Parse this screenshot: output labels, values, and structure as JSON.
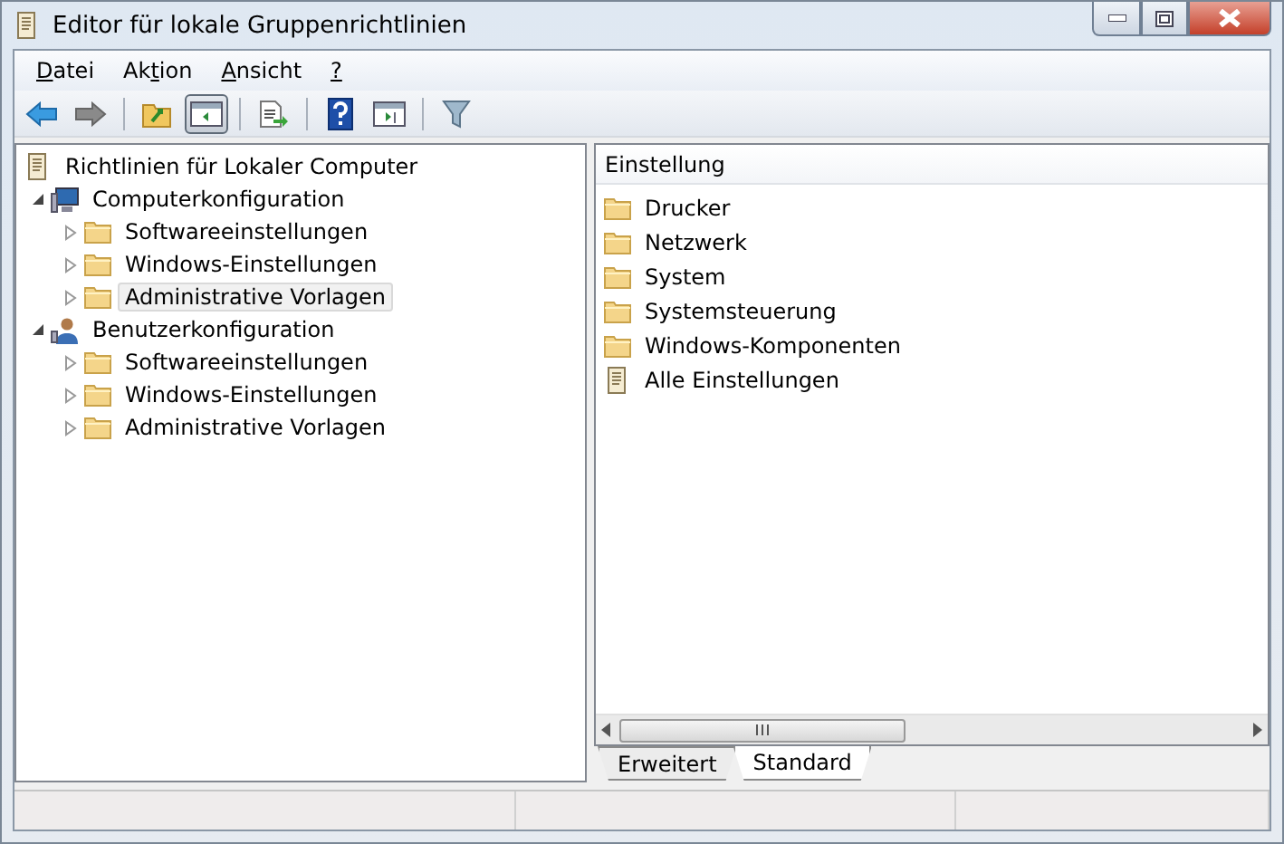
{
  "window": {
    "title": "Editor für lokale Gruppenrichtlinien"
  },
  "menu": [
    {
      "key": "D",
      "after": "atei"
    },
    {
      "before": "Ak",
      "key": "t",
      "after": "ion"
    },
    {
      "key": "A",
      "after": "nsicht"
    },
    {
      "key": "?"
    }
  ],
  "toolbar": [
    {
      "kind": "back"
    },
    {
      "kind": "forward"
    },
    {
      "kind": "sep"
    },
    {
      "kind": "up"
    },
    {
      "kind": "tree",
      "selected": true
    },
    {
      "kind": "sep"
    },
    {
      "kind": "export"
    },
    {
      "kind": "sep"
    },
    {
      "kind": "help"
    },
    {
      "kind": "pane"
    },
    {
      "kind": "sep"
    },
    {
      "kind": "filter"
    }
  ],
  "tree": {
    "label": "Richtlinien für Lokaler Computer",
    "children": [
      {
        "label": "Computerkonfiguration",
        "kind": "computer",
        "expanded": true,
        "children": [
          {
            "label": "Softwareeinstellungen",
            "selected": false,
            "expanded": false
          },
          {
            "label": "Windows-Einstellungen",
            "selected": false,
            "expanded": false
          },
          {
            "label": "Administrative Vorlagen",
            "selected": true,
            "expanded": false
          }
        ]
      },
      {
        "label": "Benutzerkonfiguration",
        "kind": "user",
        "expanded": true,
        "children": [
          {
            "label": "Softwareeinstellungen",
            "selected": false,
            "expanded": false
          },
          {
            "label": "Windows-Einstellungen",
            "selected": false,
            "expanded": false
          },
          {
            "label": "Administrative Vorlagen",
            "selected": false,
            "expanded": false
          }
        ]
      }
    ]
  },
  "list": {
    "column": "Einstellung",
    "items": [
      {
        "label": "Drucker",
        "kind": "folder"
      },
      {
        "label": "Netzwerk",
        "kind": "folder"
      },
      {
        "label": "System",
        "kind": "folder"
      },
      {
        "label": "Systemsteuerung",
        "kind": "folder"
      },
      {
        "label": "Windows-Komponenten",
        "kind": "folder"
      },
      {
        "label": "Alle Einstellungen",
        "kind": "all"
      }
    ]
  },
  "tabs": [
    {
      "label": "Erweitert",
      "selected": false
    },
    {
      "label": "Standard",
      "selected": true
    }
  ]
}
